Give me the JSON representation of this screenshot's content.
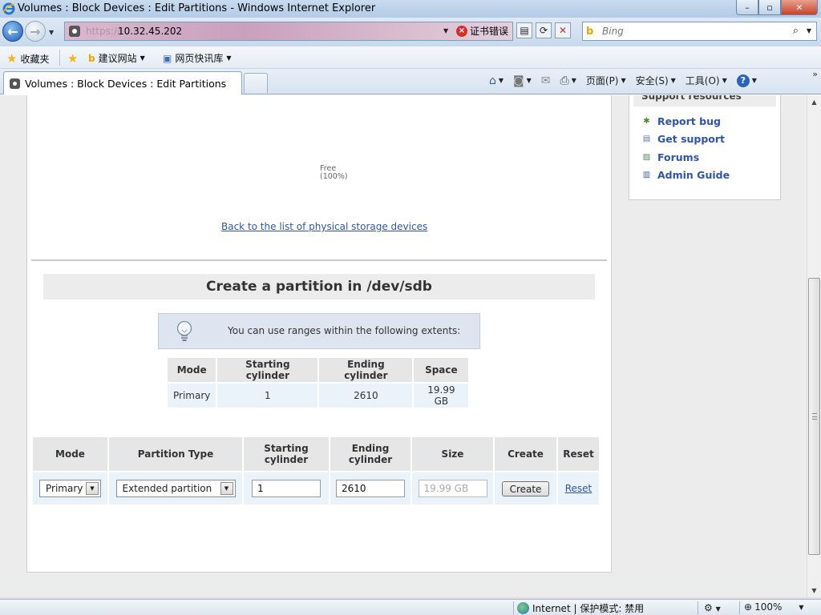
{
  "window": {
    "title": "Volumes : Block Devices : Edit Partitions - Windows Internet Explorer",
    "controls": [
      "–",
      "▫",
      "✕"
    ]
  },
  "address": {
    "protocol": "https://",
    "url": "10.32.45.202",
    "cert_error": "证书错误"
  },
  "search": {
    "placeholder": "Bing"
  },
  "favorites": {
    "label": "收藏夹",
    "items": [
      "建议网站",
      "网页快讯库"
    ]
  },
  "tab": {
    "label": "Volumes : Block Devices : Edit Partitions"
  },
  "commandbar": {
    "page": "页面(P)",
    "safety": "安全(S)",
    "tools": "工具(O)"
  },
  "main": {
    "free_label": "Free",
    "free_pct": "(100%)",
    "back_link": "Back to the list of physical storage devices",
    "heading": "Create a partition in /dev/sdb",
    "tip": "You can use ranges within the following extents:",
    "extents": {
      "headers": [
        "Mode",
        "Starting cylinder",
        "Ending cylinder",
        "Space"
      ],
      "rows": [
        [
          "Primary",
          "1",
          "2610",
          "19.99 GB"
        ]
      ]
    },
    "form": {
      "headers": [
        "Mode",
        "Partition Type",
        "Starting cylinder",
        "Ending cylinder",
        "Size",
        "Create",
        "Reset"
      ],
      "mode_value": "Primary",
      "type_value": "Extended partition",
      "start_value": "1",
      "end_value": "2610",
      "size_value": "19.99 GB",
      "create_label": "Create",
      "reset_label": "Reset"
    }
  },
  "sidebar": {
    "title": "Support resources",
    "items": [
      "Report bug",
      "Get support",
      "Forums",
      "Admin Guide"
    ]
  },
  "status": {
    "zone": "Internet | 保护模式: 禁用",
    "zoom": "100%"
  },
  "colors": {
    "link": "#2f56a6",
    "header_bg": "#e6e6e6",
    "cell_bg": "#eaf2fa",
    "tip_bg": "#dfe5f0"
  }
}
